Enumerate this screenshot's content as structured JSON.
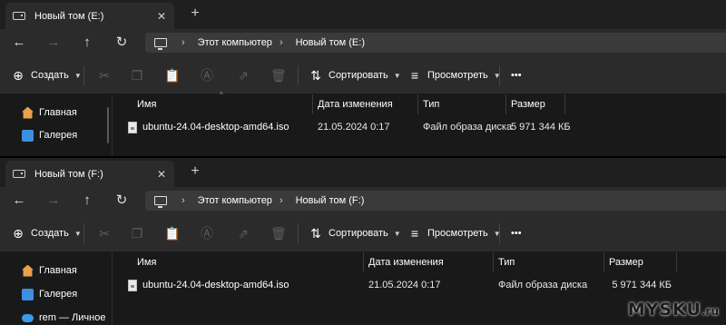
{
  "windows": [
    {
      "tab_title": "Новый том (E:)",
      "breadcrumb": [
        "Этот компьютер",
        "Новый том (E:)"
      ],
      "sidebar": [
        {
          "label": "Главная",
          "icon": "home-icon"
        },
        {
          "label": "Галерея",
          "icon": "gallery-icon"
        }
      ],
      "file": {
        "name": "ubuntu-24.04-desktop-amd64.iso",
        "date": "21.05.2024 0:17",
        "type": "Файл образа диска",
        "size": "5 971 344 КБ"
      }
    },
    {
      "tab_title": "Новый том (F:)",
      "breadcrumb": [
        "Этот компьютер",
        "Новый том (F:)"
      ],
      "sidebar": [
        {
          "label": "Главная",
          "icon": "home-icon"
        },
        {
          "label": "Галерея",
          "icon": "gallery-icon"
        },
        {
          "label": "rem — Личное",
          "icon": "cloud-icon"
        }
      ],
      "file": {
        "name": "ubuntu-24.04-desktop-amd64.iso",
        "date": "21.05.2024 0:17",
        "type": "Файл образа диска",
        "size": "5 971 344 КБ"
      }
    }
  ],
  "toolbar": {
    "create_label": "Создать",
    "sort_label": "Сортировать",
    "view_label": "Просмотреть",
    "more_label": "•••"
  },
  "columns": {
    "name": "Имя",
    "date": "Дата изменения",
    "type": "Тип",
    "size": "Размер"
  },
  "tab_close_glyph": "✕",
  "new_tab_glyph": "+",
  "watermark": {
    "brand": "MYSKU",
    "suffix": ".ru"
  },
  "colors": {
    "background": "#1c1c1c",
    "toolbar": "#2b2b2b",
    "content": "#191919"
  }
}
